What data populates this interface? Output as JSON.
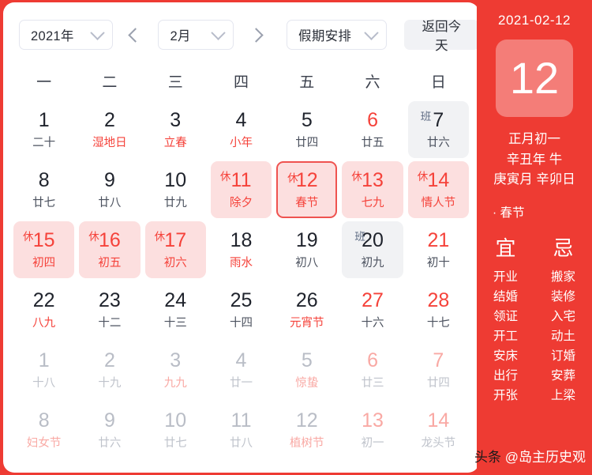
{
  "toolbar": {
    "year": "2021年",
    "month": "2月",
    "holiday_filter": "假期安排",
    "today_button": "返回今天",
    "prev_icon": "chevron-left-icon",
    "next_icon": "chevron-right-icon"
  },
  "weekdays": [
    "一",
    "二",
    "三",
    "四",
    "五",
    "六",
    "日"
  ],
  "badges": {
    "rest": "休",
    "work": "班"
  },
  "days": [
    {
      "n": "1",
      "lunar": "二十",
      "style": "",
      "badge": ""
    },
    {
      "n": "2",
      "lunar": "湿地日",
      "style": "red-l",
      "badge": ""
    },
    {
      "n": "3",
      "lunar": "立春",
      "style": "red-l",
      "badge": ""
    },
    {
      "n": "4",
      "lunar": "小年",
      "style": "red-l",
      "badge": ""
    },
    {
      "n": "5",
      "lunar": "廿四",
      "style": "",
      "badge": ""
    },
    {
      "n": "6",
      "lunar": "廿五",
      "style": "red",
      "badge": ""
    },
    {
      "n": "7",
      "lunar": "廿六",
      "style": "work",
      "badge": "班"
    },
    {
      "n": "8",
      "lunar": "廿七",
      "style": "",
      "badge": ""
    },
    {
      "n": "9",
      "lunar": "廿八",
      "style": "",
      "badge": ""
    },
    {
      "n": "10",
      "lunar": "廿九",
      "style": "",
      "badge": ""
    },
    {
      "n": "11",
      "lunar": "除夕",
      "style": "rest",
      "badge": "休"
    },
    {
      "n": "12",
      "lunar": "春节",
      "style": "rest selected",
      "badge": "休"
    },
    {
      "n": "13",
      "lunar": "七九",
      "style": "rest",
      "badge": "休"
    },
    {
      "n": "14",
      "lunar": "情人节",
      "style": "rest",
      "badge": "休"
    },
    {
      "n": "15",
      "lunar": "初四",
      "style": "rest",
      "badge": "休"
    },
    {
      "n": "16",
      "lunar": "初五",
      "style": "rest",
      "badge": "休"
    },
    {
      "n": "17",
      "lunar": "初六",
      "style": "rest",
      "badge": "休"
    },
    {
      "n": "18",
      "lunar": "雨水",
      "style": "red-l",
      "badge": ""
    },
    {
      "n": "19",
      "lunar": "初八",
      "style": "",
      "badge": ""
    },
    {
      "n": "20",
      "lunar": "初九",
      "style": "work",
      "badge": "班"
    },
    {
      "n": "21",
      "lunar": "初十",
      "style": "red",
      "badge": ""
    },
    {
      "n": "22",
      "lunar": "八九",
      "style": "red-l",
      "badge": ""
    },
    {
      "n": "23",
      "lunar": "十二",
      "style": "",
      "badge": ""
    },
    {
      "n": "24",
      "lunar": "十三",
      "style": "",
      "badge": ""
    },
    {
      "n": "25",
      "lunar": "十四",
      "style": "",
      "badge": ""
    },
    {
      "n": "26",
      "lunar": "元宵节",
      "style": "red-l",
      "badge": ""
    },
    {
      "n": "27",
      "lunar": "十六",
      "style": "red",
      "badge": ""
    },
    {
      "n": "28",
      "lunar": "十七",
      "style": "red",
      "badge": ""
    },
    {
      "n": "1",
      "lunar": "十八",
      "style": "dim",
      "badge": ""
    },
    {
      "n": "2",
      "lunar": "十九",
      "style": "dim",
      "badge": ""
    },
    {
      "n": "3",
      "lunar": "九九",
      "style": "dim red-l",
      "badge": ""
    },
    {
      "n": "4",
      "lunar": "廿一",
      "style": "dim",
      "badge": ""
    },
    {
      "n": "5",
      "lunar": "惊蛰",
      "style": "dim red-l",
      "badge": ""
    },
    {
      "n": "6",
      "lunar": "廿三",
      "style": "dim red",
      "badge": ""
    },
    {
      "n": "7",
      "lunar": "廿四",
      "style": "dim red",
      "badge": ""
    },
    {
      "n": "8",
      "lunar": "妇女节",
      "style": "dim red-l",
      "badge": ""
    },
    {
      "n": "9",
      "lunar": "廿六",
      "style": "dim",
      "badge": ""
    },
    {
      "n": "10",
      "lunar": "廿七",
      "style": "dim",
      "badge": ""
    },
    {
      "n": "11",
      "lunar": "廿八",
      "style": "dim",
      "badge": ""
    },
    {
      "n": "12",
      "lunar": "植树节",
      "style": "dim red-l",
      "badge": ""
    },
    {
      "n": "13",
      "lunar": "初一",
      "style": "dim red",
      "badge": ""
    },
    {
      "n": "14",
      "lunar": "龙头节",
      "style": "dim red",
      "badge": ""
    }
  ],
  "panel": {
    "date": "2021-02-12",
    "big_day": "12",
    "lunar_day": "正月初一",
    "ganzhi_year": "辛丑年 牛",
    "ganzhi_month_day": "庚寅月 辛卯日",
    "festival": "· 春节",
    "yi_head": "宜",
    "ji_head": "忌",
    "yi_items": [
      "开业",
      "结婚",
      "领证",
      "开工",
      "安床",
      "出行",
      "开张"
    ],
    "ji_items": [
      "搬家",
      "装修",
      "入宅",
      "动土",
      "订婚",
      "安葬",
      "上梁"
    ]
  },
  "watermark": {
    "tag": "头条",
    "account": " @岛主历史观"
  },
  "colors": {
    "brand_red": "#ee3b33",
    "text_red": "#f5423a",
    "rest_bg": "#fcdfdf",
    "work_bg": "#f1f2f4",
    "selected_border": "#ef5350"
  }
}
